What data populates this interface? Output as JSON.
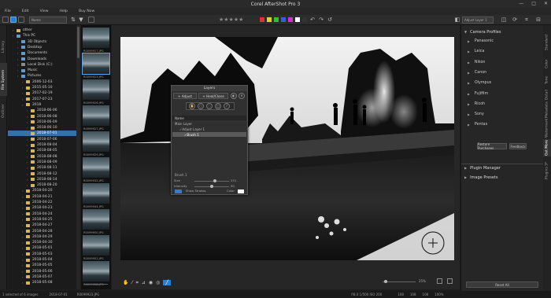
{
  "window": {
    "title": "Corel AfterShot Pro 3",
    "controls": [
      "—",
      "□",
      "✕"
    ]
  },
  "menu": [
    "File",
    "Edit",
    "View",
    "Help",
    "Buy Now"
  ],
  "toolbar": {
    "sort_select": "Name",
    "layer_select": "Adjust Layer 1",
    "stars": "★★★★★",
    "colors": [
      "#e03030",
      "#e0d030",
      "#30c030",
      "#3060e0",
      "#d030d0",
      "#ffffff",
      "#333333"
    ]
  },
  "left_tabs": [
    "Library",
    "File System",
    "Outliner"
  ],
  "tree": [
    {
      "label": "other",
      "depth": 1,
      "type": "folder"
    },
    {
      "label": "This PC",
      "depth": 1,
      "type": "pc"
    },
    {
      "label": "3D Objects",
      "depth": 2,
      "type": "blue"
    },
    {
      "label": "Desktop",
      "depth": 2,
      "type": "blue"
    },
    {
      "label": "Documents",
      "depth": 2,
      "type": "blue"
    },
    {
      "label": "Downloads",
      "depth": 2,
      "type": "blue"
    },
    {
      "label": "Local Disk (C:)",
      "depth": 2,
      "type": "drive"
    },
    {
      "label": "Music",
      "depth": 2,
      "type": "blue"
    },
    {
      "label": "Pictures",
      "depth": 2,
      "type": "blue"
    },
    {
      "label": "2006-12-03",
      "depth": 3,
      "type": "folder"
    },
    {
      "label": "2015-05-10",
      "depth": 3,
      "type": "folder"
    },
    {
      "label": "2017-02-19",
      "depth": 3,
      "type": "folder"
    },
    {
      "label": "2017-07-23",
      "depth": 3,
      "type": "folder"
    },
    {
      "label": "2018",
      "depth": 3,
      "type": "folder"
    },
    {
      "label": "2018-06-06",
      "depth": 4,
      "type": "folder"
    },
    {
      "label": "2018-06-08",
      "depth": 4,
      "type": "folder"
    },
    {
      "label": "2018-06-09",
      "depth": 4,
      "type": "folder"
    },
    {
      "label": "2018-06-10",
      "depth": 4,
      "type": "folder"
    },
    {
      "label": "2018-07-01",
      "depth": 4,
      "type": "folder",
      "selected": true
    },
    {
      "label": "2018-07-06",
      "depth": 4,
      "type": "folder"
    },
    {
      "label": "2018-08-04",
      "depth": 4,
      "type": "folder"
    },
    {
      "label": "2018-08-05",
      "depth": 4,
      "type": "folder"
    },
    {
      "label": "2018-08-08",
      "depth": 4,
      "type": "folder"
    },
    {
      "label": "2018-08-09",
      "depth": 4,
      "type": "folder"
    },
    {
      "label": "2018-08-11",
      "depth": 4,
      "type": "folder"
    },
    {
      "label": "2018-08-12",
      "depth": 4,
      "type": "folder"
    },
    {
      "label": "2018-08-14",
      "depth": 4,
      "type": "folder"
    },
    {
      "label": "2018-08-20",
      "depth": 4,
      "type": "folder"
    },
    {
      "label": "2018-04-20",
      "depth": 3,
      "type": "folder"
    },
    {
      "label": "2018-04-21",
      "depth": 3,
      "type": "folder"
    },
    {
      "label": "2018-04-22",
      "depth": 3,
      "type": "folder"
    },
    {
      "label": "2018-04-23",
      "depth": 3,
      "type": "folder"
    },
    {
      "label": "2018-04-24",
      "depth": 3,
      "type": "folder"
    },
    {
      "label": "2018-04-25",
      "depth": 3,
      "type": "folder"
    },
    {
      "label": "2018-04-27",
      "depth": 3,
      "type": "folder"
    },
    {
      "label": "2018-04-28",
      "depth": 3,
      "type": "folder"
    },
    {
      "label": "2018-04-29",
      "depth": 3,
      "type": "folder"
    },
    {
      "label": "2018-04-30",
      "depth": 3,
      "type": "folder"
    },
    {
      "label": "2018-05-01",
      "depth": 3,
      "type": "folder"
    },
    {
      "label": "2018-05-03",
      "depth": 3,
      "type": "folder"
    },
    {
      "label": "2018-05-04",
      "depth": 3,
      "type": "folder"
    },
    {
      "label": "2018-05-05",
      "depth": 3,
      "type": "folder"
    },
    {
      "label": "2018-05-06",
      "depth": 3,
      "type": "folder"
    },
    {
      "label": "2018-05-07",
      "depth": 3,
      "type": "folder"
    },
    {
      "label": "2018-05-08",
      "depth": 3,
      "type": "folder"
    }
  ],
  "filmstrip": [
    {
      "label": "R0099917.JPG"
    },
    {
      "label": "R0099923.JPG",
      "selected": true
    },
    {
      "label": "R0099926.JPG"
    },
    {
      "label": "R0099927.JPG"
    },
    {
      "label": "R0099929.JPG"
    },
    {
      "label": "R0099932.JPG"
    },
    {
      "label": "R0099944.JPG"
    },
    {
      "label": "R0099950.JPG"
    },
    {
      "label": "R0099952.JPG"
    },
    {
      "label": "R0099958.JPG"
    }
  ],
  "layers_panel": {
    "title": "Layers",
    "add_adjust": "+ Adjust",
    "add_heal": "+ Heal/Clone",
    "header": "Name",
    "rows": [
      {
        "label": "Main Layer",
        "indent": 0
      },
      {
        "label": "Adjust Layer 1",
        "indent": 1,
        "check": true
      },
      {
        "label": "Brush 1",
        "indent": 2,
        "check": true,
        "selected": true
      }
    ],
    "brush_label": "Brush 1",
    "sliders": [
      {
        "label": "Size",
        "value": "231",
        "level": 0.6
      },
      {
        "label": "Intensity",
        "value": "50",
        "level": 0.5
      }
    ],
    "show_strokes": "Show Strokes",
    "color_label": "Color"
  },
  "right_panel": {
    "camera_profiles": "Camera Profiles",
    "brands": [
      "Panasonic",
      "Leica",
      "Nikon",
      "Canon",
      "Olympus",
      "Fujifilm",
      "Ricoh",
      "Sony",
      "Pentax"
    ],
    "restore_btn": "Restore Purchases",
    "feedback_btn": "Feedback",
    "plugin_manager": "Plugin Manager",
    "image_presets": "Image Presets",
    "reset_all": "Reset All"
  },
  "right_tabs": [
    "Standard",
    "Color",
    "Tone",
    "Detail",
    "Metadata",
    "Watermark",
    "Get More",
    "Plugins 3*"
  ],
  "zoom": "25%",
  "status": {
    "left": "1 selected of 6 images",
    "date": "2018-07-01",
    "file": "R0099923.JPG",
    "exif": "f/8.0  1/500  ISO 200",
    "right_vals": [
      "108",
      "108",
      "108",
      "100%"
    ]
  }
}
